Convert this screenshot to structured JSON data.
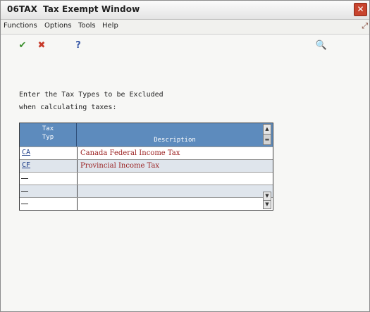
{
  "window": {
    "code": "06TAX",
    "title": "Tax Exempt Window",
    "close_glyph": "✕"
  },
  "menu": {
    "items": [
      "Functions",
      "Options",
      "Tools",
      "Help"
    ]
  },
  "toolbar": {
    "ok_glyph": "✔",
    "cancel_glyph": "✖",
    "help_glyph": "?",
    "search_glyph": "🔍"
  },
  "prompt": {
    "line1": "Enter the Tax Types to be Excluded",
    "line2": "when calculating taxes:"
  },
  "grid": {
    "columns": {
      "code_line1": "Tax",
      "code_line2": "Typ",
      "description": "Description"
    },
    "rows": [
      {
        "code": "CA",
        "description": "Canada Federal Income Tax"
      },
      {
        "code": "CF",
        "description": "Provincial Income Tax"
      },
      {
        "code": "",
        "description": ""
      },
      {
        "code": "",
        "description": ""
      },
      {
        "code": "",
        "description": ""
      }
    ]
  },
  "scrollbar": {
    "up_glyph": "▲",
    "thumb_glyph": "▬",
    "down_glyph": "▼"
  },
  "colors": {
    "header_blue": "#5d8bbd",
    "description_text": "#9a1f1f",
    "code_text": "#1f3f8a",
    "alt_row": "#dfe5ec"
  }
}
